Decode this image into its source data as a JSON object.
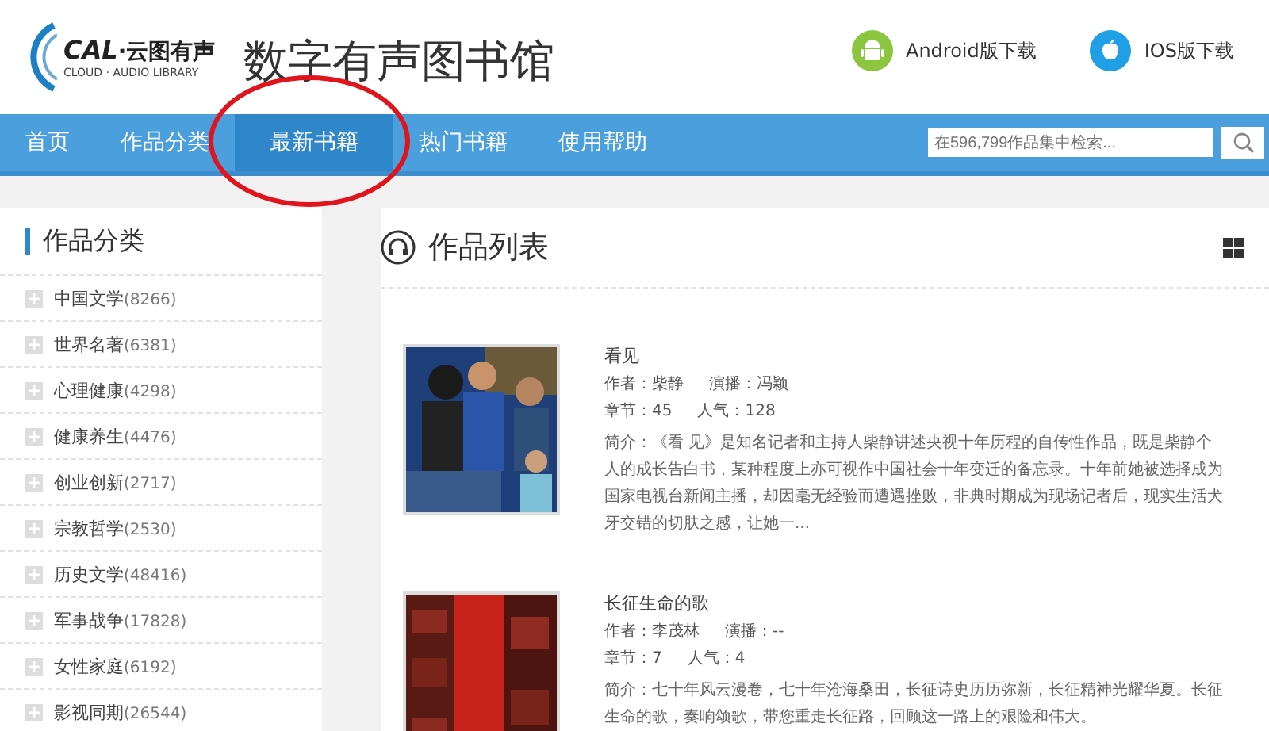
{
  "logo": {
    "mark": "CAL",
    "name": "·云图有声",
    "tagline": "CLOUD · AUDIO LIBRARY"
  },
  "site_title": "数字有声图书馆",
  "downloads": [
    {
      "kind": "android",
      "label": "Android版下载"
    },
    {
      "kind": "ios",
      "label": "IOS版下载"
    }
  ],
  "nav": [
    {
      "label": "首页",
      "selected": false
    },
    {
      "label": "作品分类",
      "selected": false
    },
    {
      "label": "最新书籍",
      "selected": true
    },
    {
      "label": "热门书籍",
      "selected": false
    },
    {
      "label": "使用帮助",
      "selected": false
    }
  ],
  "search": {
    "placeholder": "在596,799作品集中检索..."
  },
  "sidebar": {
    "title": "作品分类",
    "categories": [
      {
        "name": "中国文学",
        "count": "(8266)"
      },
      {
        "name": "世界名著",
        "count": "(6381)"
      },
      {
        "name": "心理健康",
        "count": "(4298)"
      },
      {
        "name": "健康养生",
        "count": "(4476)"
      },
      {
        "name": "创业创新",
        "count": "(2717)"
      },
      {
        "name": "宗教哲学",
        "count": "(2530)"
      },
      {
        "name": "历史文学",
        "count": "(48416)"
      },
      {
        "name": "军事战争",
        "count": "(17828)"
      },
      {
        "name": "女性家庭",
        "count": "(6192)"
      },
      {
        "name": "影视同期",
        "count": "(26544)"
      }
    ]
  },
  "list": {
    "title": "作品列表",
    "books": [
      {
        "title": "看见",
        "author": "作者：柴静",
        "narrator": "演播：冯颖",
        "chapters": "章节：45",
        "popularity": "人气：128",
        "summary": "简介：《看 见》是知名记者和主持人柴静讲述央视十年历程的自传性作品，既是柴静个人的成长告白书，某种程度上亦可视作中国社会十年变迁的备忘录。十年前她被选择成为国家电视台新闻主播，却因毫无经验而遭遇挫败，非典时期成为现场记者后，现实生活犬牙交错的切肤之感，让她一..."
      },
      {
        "title": "长征生命的歌",
        "author": "作者：李茂林",
        "narrator": "演播：--",
        "chapters": "章节：7",
        "popularity": "人气：4",
        "summary": "简介：七十年风云漫卷，七十年沧海桑田，长征诗史历历弥新，长征精神光耀华夏。长征生命的歌，奏响颂歌，带您重走长征路，回顾这一路上的艰险和伟大。"
      }
    ]
  }
}
